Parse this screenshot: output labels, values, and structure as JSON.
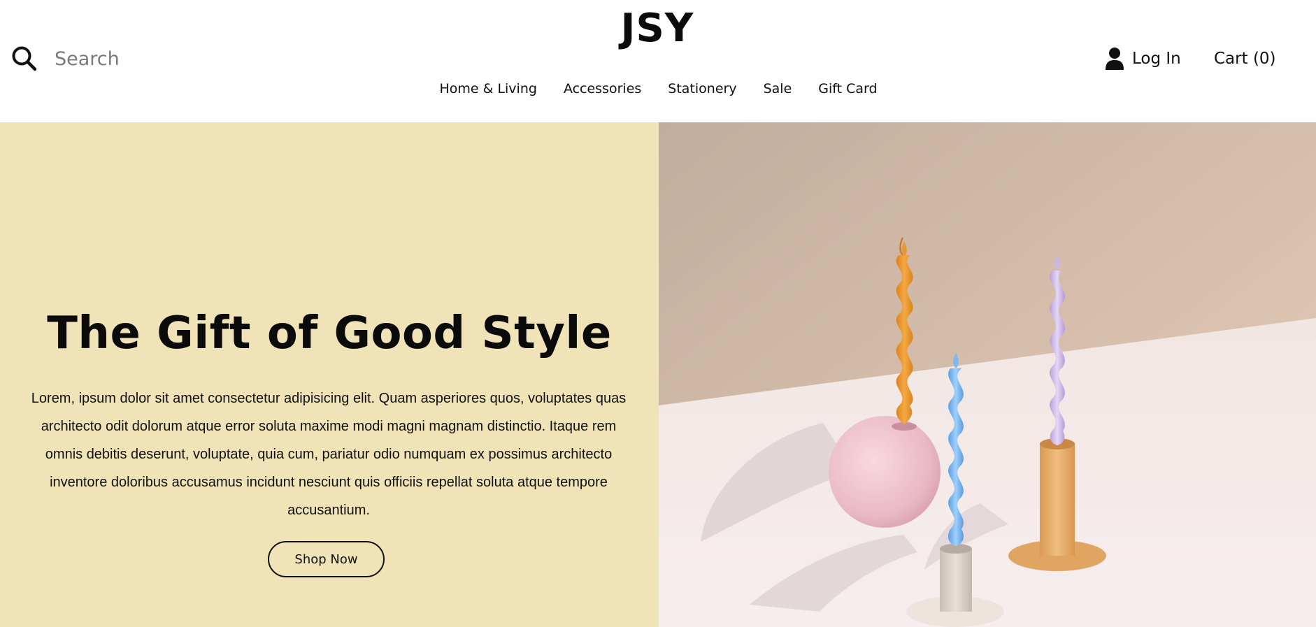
{
  "brand": {
    "logo_text": "JSY"
  },
  "search": {
    "placeholder": "Search",
    "icon": "search-icon"
  },
  "account": {
    "login_label": "Log In",
    "icon": "user-icon"
  },
  "cart": {
    "label": "Cart (0)"
  },
  "nav": {
    "items": [
      {
        "label": "Home & Living"
      },
      {
        "label": "Accessories"
      },
      {
        "label": "Stationery"
      },
      {
        "label": "Sale"
      },
      {
        "label": "Gift Card"
      }
    ]
  },
  "hero": {
    "title": "The Gift of Good Style",
    "body": "Lorem, ipsum dolor sit amet consectetur adipisicing elit. Quam asperiores quos, voluptates quas architecto odit dolorum atque error soluta maxime modi magni magnam distinctio. Itaque rem omnis debitis deserunt, voluptate, quia cum, pariatur odio numquam ex possimus architecto inventore doloribus accusamus incidunt nesciunt quis officiis repellat soluta atque tempore accusantium.",
    "cta_label": "Shop Now",
    "image": "twisted-candles-photo"
  },
  "colors": {
    "hero_panel": "#f0e3b8",
    "text": "#111111",
    "background": "#ffffff"
  }
}
